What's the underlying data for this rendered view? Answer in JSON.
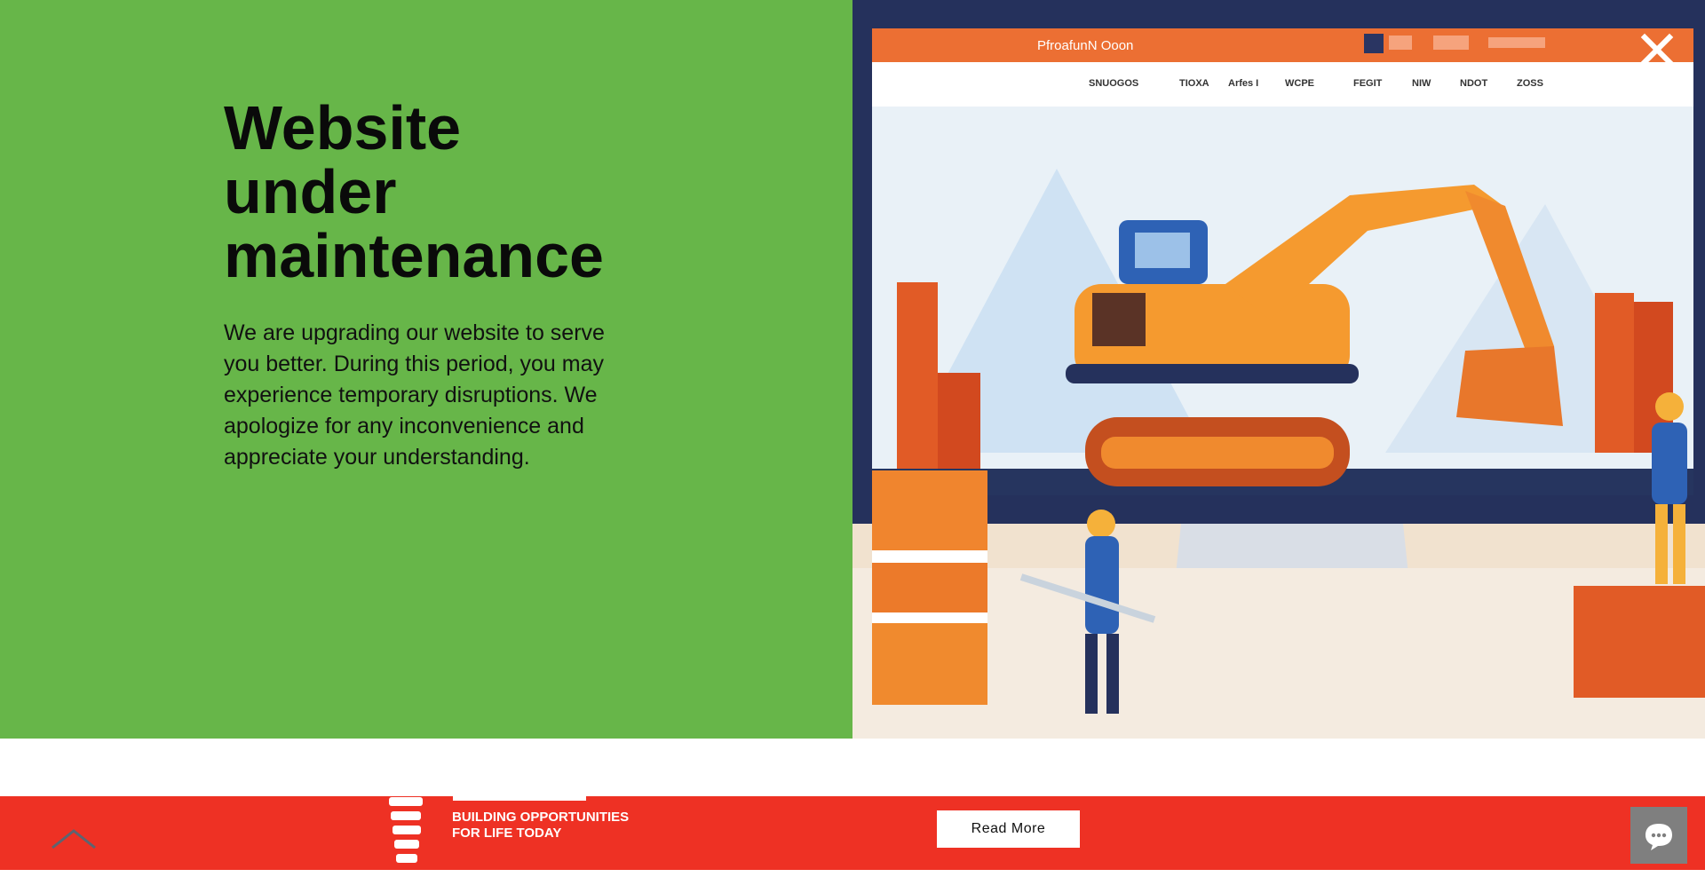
{
  "modal": {
    "heading": [
      "Website",
      "under",
      "maintenance"
    ],
    "body": "We are upgrading our website to serve you better. During this period, you may experience temporary disruptions. We apologize for any inconvenience and appreciate your understanding.",
    "close_icon": "close-icon",
    "illustration": {
      "topbar_text": "PfroafunN Ooon",
      "nav": [
        "SNUOGOS",
        "TIOXA",
        "Arfes I",
        "WCPE",
        "FEGIT",
        "NIW",
        "NDOT",
        "ZOSS"
      ]
    }
  },
  "footer": {
    "logo_mark": "BOLT",
    "tagline": [
      "BUILDING OPPORTUNITIES",
      "FOR LIFE TODAY"
    ],
    "read_more_label": "Read More",
    "back_to_top_icon": "chevron-up-icon",
    "chat_icon": "chat-bubble-icon"
  },
  "colors": {
    "green": "#67b649",
    "red": "#ee3124",
    "chat_bg": "#7f7f7f"
  }
}
